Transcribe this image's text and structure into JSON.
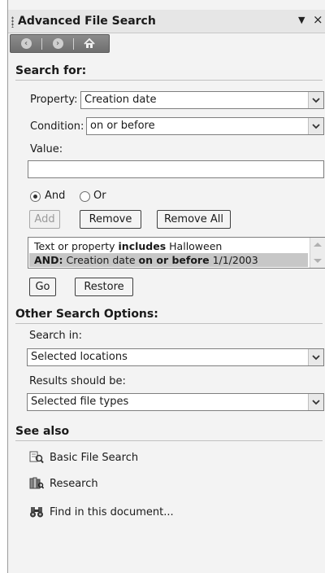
{
  "panel": {
    "title": "Advanced File Search",
    "dropdown_glyph": "▼",
    "close_glyph": "×"
  },
  "nav": {
    "back_icon": "back-arrow-icon",
    "forward_icon": "forward-arrow-icon",
    "home_icon": "home-icon"
  },
  "search_for": {
    "heading": "Search for:",
    "property_label": "Property:",
    "property_value": "Creation date",
    "condition_label": "Condition:",
    "condition_value": "on or before",
    "value_label": "Value:",
    "value_input": "",
    "radio_and": "And",
    "radio_or": "Or",
    "selected_radio": "And",
    "add_label": "Add",
    "remove_label": "Remove",
    "remove_all_label": "Remove All",
    "criteria": [
      {
        "prefix": "",
        "field": "Text or property",
        "op": "includes",
        "value": "Halloween"
      },
      {
        "prefix": "AND:",
        "field": "Creation date",
        "op": "on or before",
        "value": "1/1/2003"
      }
    ],
    "go_label": "Go",
    "restore_label": "Restore"
  },
  "other_options": {
    "heading": "Other Search Options:",
    "search_in_label": "Search in:",
    "search_in_value": "Selected locations",
    "results_label": "Results should be:",
    "results_value": "Selected file types"
  },
  "see_also": {
    "heading": "See also",
    "links": [
      {
        "label": "Basic File Search",
        "icon": "basic-search-icon"
      },
      {
        "label": "Research",
        "icon": "research-icon"
      },
      {
        "label": "Find in this document...",
        "icon": "binoculars-icon"
      }
    ]
  },
  "colors": {
    "panel_bg": "#f3f3f3",
    "selection": "#c7c7c7",
    "nav_bar": "#7d7d7d"
  }
}
